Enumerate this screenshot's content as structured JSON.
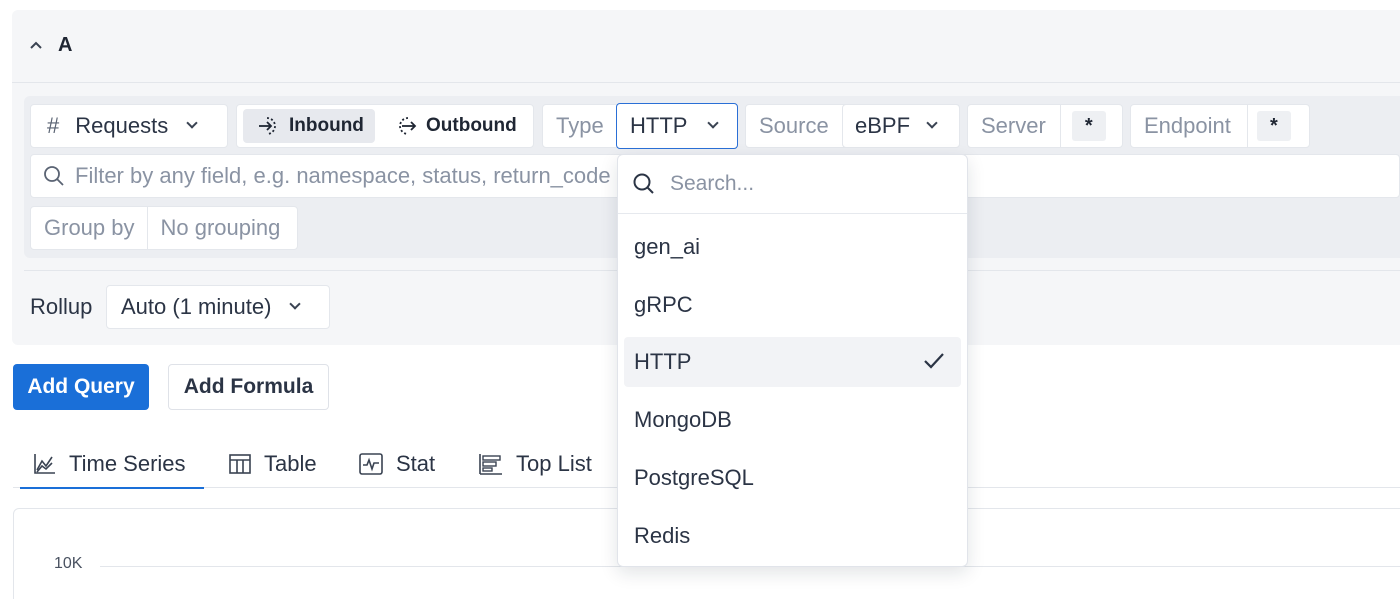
{
  "query": {
    "letter": "A"
  },
  "metric": {
    "hash": "#",
    "label": "Requests"
  },
  "direction": {
    "inbound": "Inbound",
    "outbound": "Outbound"
  },
  "type_filter": {
    "label": "Type",
    "value": "HTTP"
  },
  "source_filter": {
    "label": "Source",
    "value": "eBPF"
  },
  "server_filter": {
    "label": "Server",
    "value": "*"
  },
  "endpoint_filter": {
    "label": "Endpoint",
    "value": "*"
  },
  "filter": {
    "placeholder": "Filter by any field, e.g. namespace, status, return_code"
  },
  "group_by": {
    "label": "Group by",
    "value": "No grouping"
  },
  "rollup": {
    "label": "Rollup",
    "value": "Auto (1 minute)"
  },
  "buttons": {
    "add_query": "Add Query",
    "add_formula": "Add Formula"
  },
  "tabs": [
    {
      "label": "Time Series",
      "icon": "time-series-icon",
      "active": true
    },
    {
      "label": "Table",
      "icon": "table-icon",
      "active": false
    },
    {
      "label": "Stat",
      "icon": "stat-icon",
      "active": false
    },
    {
      "label": "Top List",
      "icon": "top-list-icon",
      "active": false
    }
  ],
  "chart": {
    "y_tick": "10K"
  },
  "dropdown": {
    "search_placeholder": "Search...",
    "options": [
      "gen_ai",
      "gRPC",
      "HTTP",
      "MongoDB",
      "PostgreSQL",
      "Redis"
    ],
    "selected": "HTTP"
  },
  "colors": {
    "accent": "#1a6fd8",
    "panel": "#f5f6f8",
    "builder": "#eceef2"
  }
}
